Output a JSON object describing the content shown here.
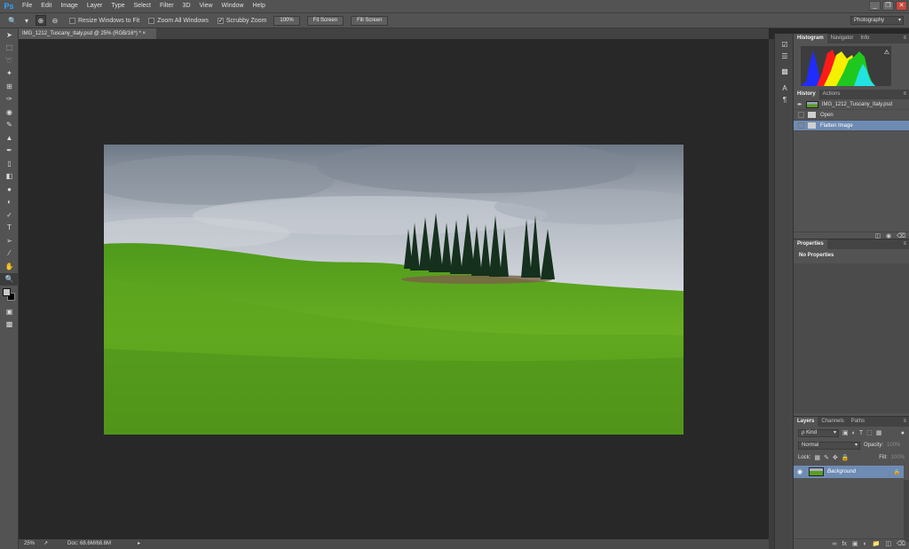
{
  "app": {
    "logo": "Ps"
  },
  "menu": [
    "File",
    "Edit",
    "Image",
    "Layer",
    "Type",
    "Select",
    "Filter",
    "3D",
    "View",
    "Window",
    "Help"
  ],
  "window_controls": [
    "_",
    "❐",
    "✕"
  ],
  "options": {
    "zoom_icon": "zoom-tool-icon",
    "resize_windows": "Resize Windows to Fit",
    "zoom_all_windows": "Zoom All Windows",
    "scrubby_zoom": "Scrubby Zoom",
    "btn_100": "100%",
    "btn_fit_screen": "Fit Screen",
    "btn_fill_screen": "Fill Screen",
    "workspace": "Photography"
  },
  "document_tab": "IMG_1212_Tuscany_Italy.psd @ 25% (RGB/16*) *  ×",
  "status": {
    "zoom": "25%",
    "doc": "Doc: 68.6M/68.6M"
  },
  "histogram_tabs": [
    "Histogram",
    "Navigator",
    "Info"
  ],
  "history_tabs": [
    "History",
    "Actions"
  ],
  "history_items": [
    {
      "label": "IMG_1212_Tuscany_Italy.psd",
      "type": "snapshot"
    },
    {
      "label": "Open",
      "type": "step"
    },
    {
      "label": "Flatten Image",
      "type": "step",
      "selected": true
    }
  ],
  "properties": {
    "tab": "Properties",
    "empty_label": "No Properties"
  },
  "layers_tabs": [
    "Layers",
    "Channels",
    "Paths"
  ],
  "layers": {
    "kind_label": "ρ Kind",
    "blend_mode": "Normal",
    "opacity_label": "Opacity:",
    "opacity_value": "100%",
    "lock_label": "Lock:",
    "fill_label": "Fill:",
    "fill_value": "100%",
    "layer_name": "Background"
  },
  "colors": {
    "selection": "#6e8bb4",
    "panel": "#535353",
    "canvas_bg": "#282828",
    "ps_blue": "#2fa3ff"
  }
}
